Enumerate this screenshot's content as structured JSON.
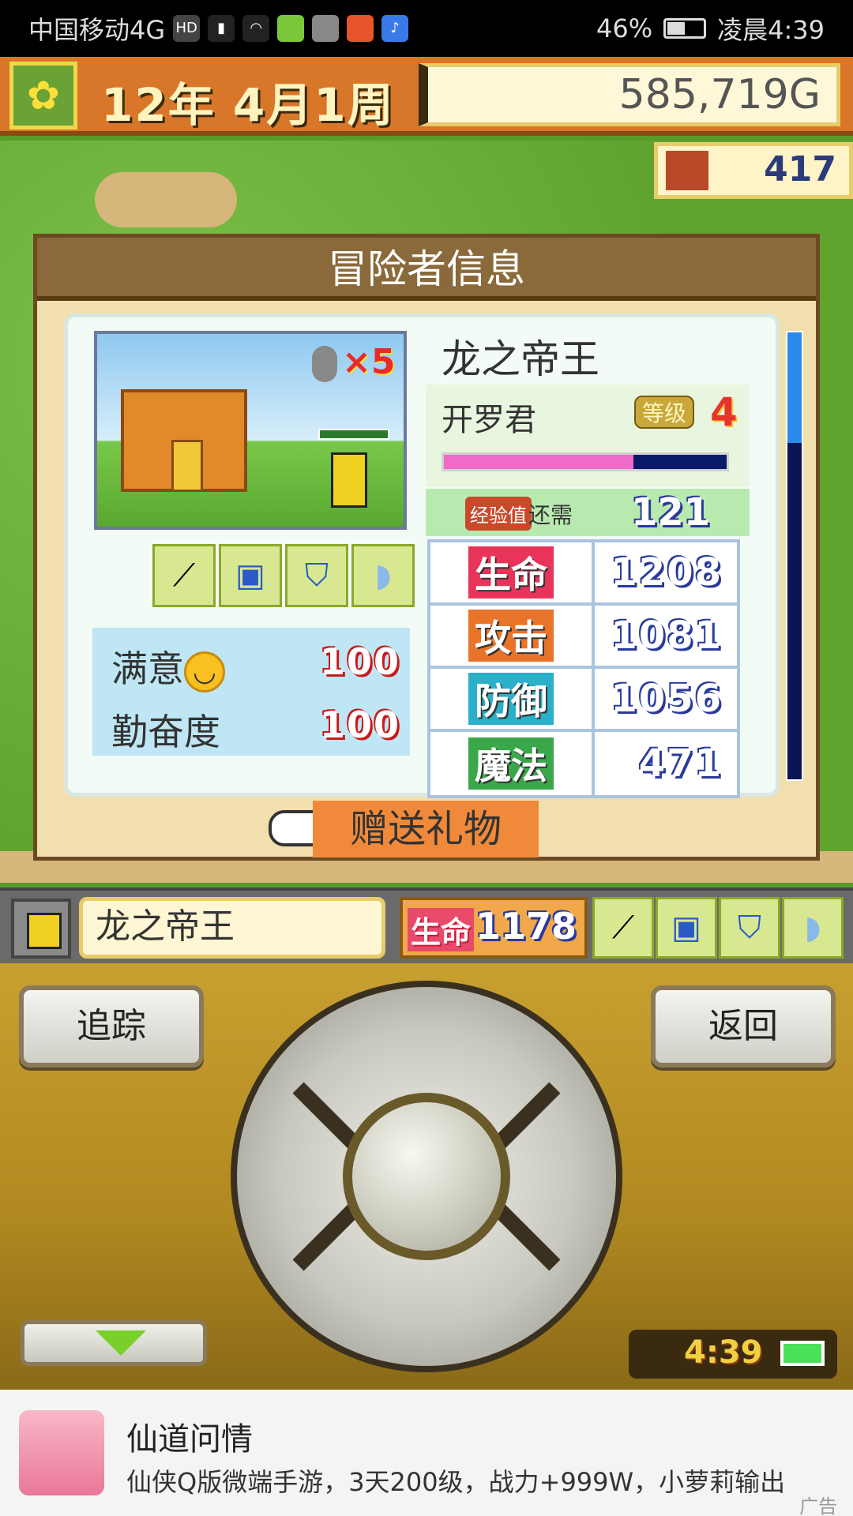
{
  "status_bar": {
    "carrier": "中国移动4G",
    "battery": "46%",
    "time": "凌晨4:39"
  },
  "top": {
    "date": "12年 4月1周",
    "gold": "585,719G",
    "population": "417"
  },
  "panel": {
    "title": "冒险者信息",
    "medal_count": "×5",
    "adventurer_name": "龙之帝王",
    "job": "开罗君",
    "level_label": "等级",
    "level": "4",
    "exp_progress": 0.67,
    "exp_badge": "经验值",
    "exp_need_label": "还需",
    "exp_need": "121",
    "mood": [
      {
        "label": "满意",
        "value": "100"
      },
      {
        "label": "勤奋度",
        "value": "100"
      }
    ],
    "stats": [
      {
        "label": "生命",
        "value": "1208",
        "color": "#e8345a"
      },
      {
        "label": "攻击",
        "value": "1081",
        "color": "#e8742a"
      },
      {
        "label": "防御",
        "value": "1056",
        "color": "#2ab0c8"
      },
      {
        "label": "魔法",
        "value": "471",
        "color": "#3aa84a"
      }
    ],
    "gift_button": "赠送礼物"
  },
  "strip": {
    "name": "龙之帝王",
    "hp_label": "生命",
    "hp_value": "1178"
  },
  "controls": {
    "track_button": "追踪",
    "back_button": "返回",
    "clock": "4:39"
  },
  "ad": {
    "title": "仙道问情",
    "desc": "仙侠Q版微端手游，3天200级，战力+999W，小萝莉输出",
    "tag": "广告"
  }
}
